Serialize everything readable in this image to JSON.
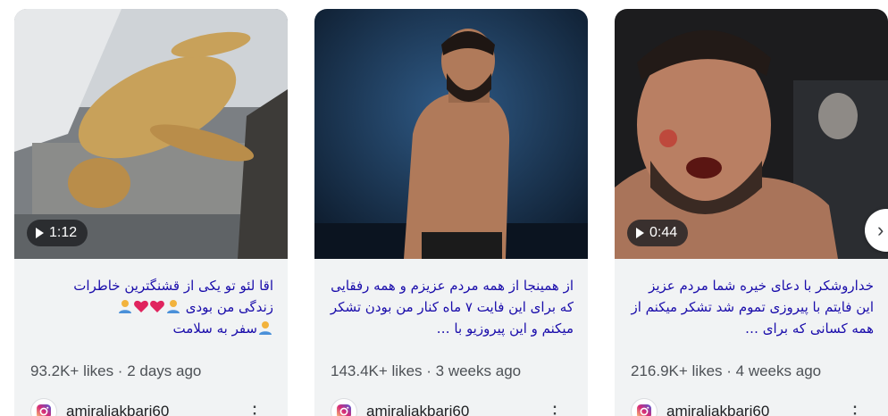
{
  "cards": [
    {
      "duration": "1:12",
      "title_line1": "اقا لئو تو یکی از قشنگترین خاطرات",
      "title_line2": "زندگی من بودی",
      "title_line3": "سفر به سلامت",
      "meta": "93.2K+ likes · 2 days ago",
      "author": "amiraliakbari60"
    },
    {
      "duration": "",
      "title": "از همینجا از همه مردم عزیزم و همه رفقایی که برای این فایت ۷ ماه کنار من بودن تشکر میکنم و این پیروزیو با …",
      "meta": "143.4K+ likes · 3 weeks ago",
      "author": "amiraliakbari60"
    },
    {
      "duration": "0:44",
      "title": "خداروشکر با دعای خیره شما مردم عزیز این فایتم با پیروزی تموم شد تشکر میکنم از همه کسانی که برای …",
      "meta": "216.9K+ likes · 4 weeks ago",
      "author": "amiraliakbari60"
    }
  ],
  "icons": {
    "play": "play-icon",
    "instagram": "instagram-icon",
    "more": "more-vert-icon",
    "next": "chevron-right-icon"
  },
  "colors": {
    "title": "#1a0dab",
    "card_bg": "#f1f3f4"
  }
}
